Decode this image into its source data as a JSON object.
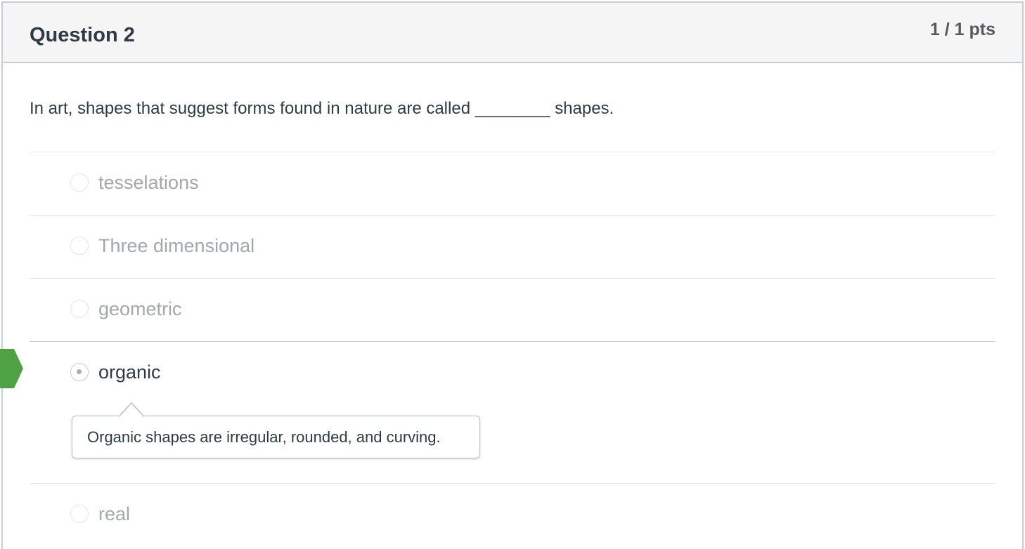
{
  "question": {
    "title": "Question 2",
    "points": "1 / 1 pts",
    "prompt": "In art, shapes that suggest forms found in nature are called ________ shapes."
  },
  "answers": [
    {
      "label": "tesselations",
      "selected": false
    },
    {
      "label": "Three dimensional",
      "selected": false
    },
    {
      "label": "geometric",
      "selected": false
    },
    {
      "label": "organic",
      "selected": true,
      "comment": "Organic shapes are irregular, rounded, and curving."
    },
    {
      "label": "real",
      "selected": false
    }
  ],
  "colors": {
    "correct_flag": "#4ea243",
    "header_bg": "#f5f5f5",
    "border": "#c7cdd1",
    "text": "#2d3b45",
    "muted_text": "#a3a8ac"
  },
  "icons": {
    "correct_flag": "correct-answer-flag-icon"
  }
}
